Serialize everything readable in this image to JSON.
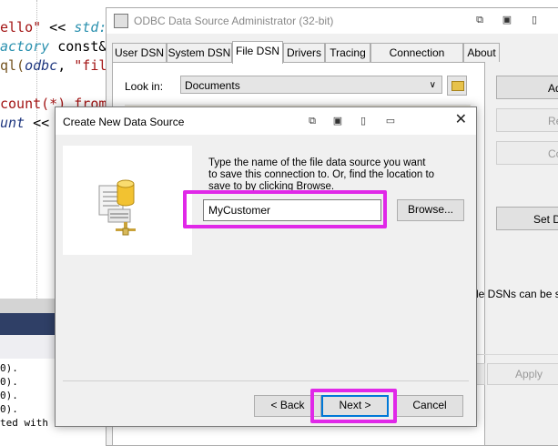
{
  "editor": {
    "lines": [
      {
        "segments": [
          {
            "t": "ello\"",
            "c": "c-str"
          },
          {
            "t": " << ",
            "c": "c-id"
          },
          {
            "t": "std:",
            "c": "c-it"
          }
        ]
      },
      {
        "segments": [
          {
            "t": "actory",
            "c": "c-it"
          },
          {
            "t": " const&",
            "c": "c-id"
          }
        ]
      },
      {
        "segments": [
          {
            "t": "ql(",
            "c": "c-fn"
          },
          {
            "t": "odbc",
            "c": "c-var"
          },
          {
            "t": ", ",
            "c": "c-id"
          },
          {
            "t": "\"fil",
            "c": "c-str"
          }
        ]
      },
      {
        "segments": [
          {
            "t": "count(*) from",
            "c": "c-str"
          }
        ]
      },
      {
        "segments": [
          {
            "t": "unt",
            "c": "c-var"
          },
          {
            "t": " <<",
            "c": "c-id"
          }
        ]
      }
    ]
  },
  "output": {
    "lines": [
      "0).",
      "0).",
      "0).",
      "0).",
      "ted with c"
    ]
  },
  "odbc": {
    "title": "ODBC Data Source Administrator (32-bit)",
    "tabs": [
      "User DSN",
      "System DSN",
      "File DSN",
      "Drivers",
      "Tracing",
      "Connection Pooling",
      "About"
    ],
    "active_tab": "File DSN",
    "look_in_label": "Look in:",
    "look_in_value": "Documents",
    "side_buttons": [
      "Add",
      "Remove",
      "Configure",
      "Set Directory"
    ],
    "info_text": "le DSNs can be sh",
    "apply_label": "Apply"
  },
  "wizard": {
    "title": "Create New Data Source",
    "instructions": "Type the name of the file data source you want to save this connection to.  Or, find the location to save to by clicking Browse.",
    "name_value": "MyCustomer",
    "browse_label": "Browse...",
    "back_label": "< Back",
    "next_label": "Next >",
    "cancel_label": "Cancel"
  },
  "colors": {
    "highlight": "#e028e8",
    "default_button_border": "#0078d7"
  },
  "icons": [
    "window-app-icon",
    "snap-icon",
    "maximize-icon",
    "restore-icon",
    "minimize-icon",
    "chevron-down-icon",
    "folder-up-icon",
    "close-icon",
    "database-wizard-icon"
  ]
}
